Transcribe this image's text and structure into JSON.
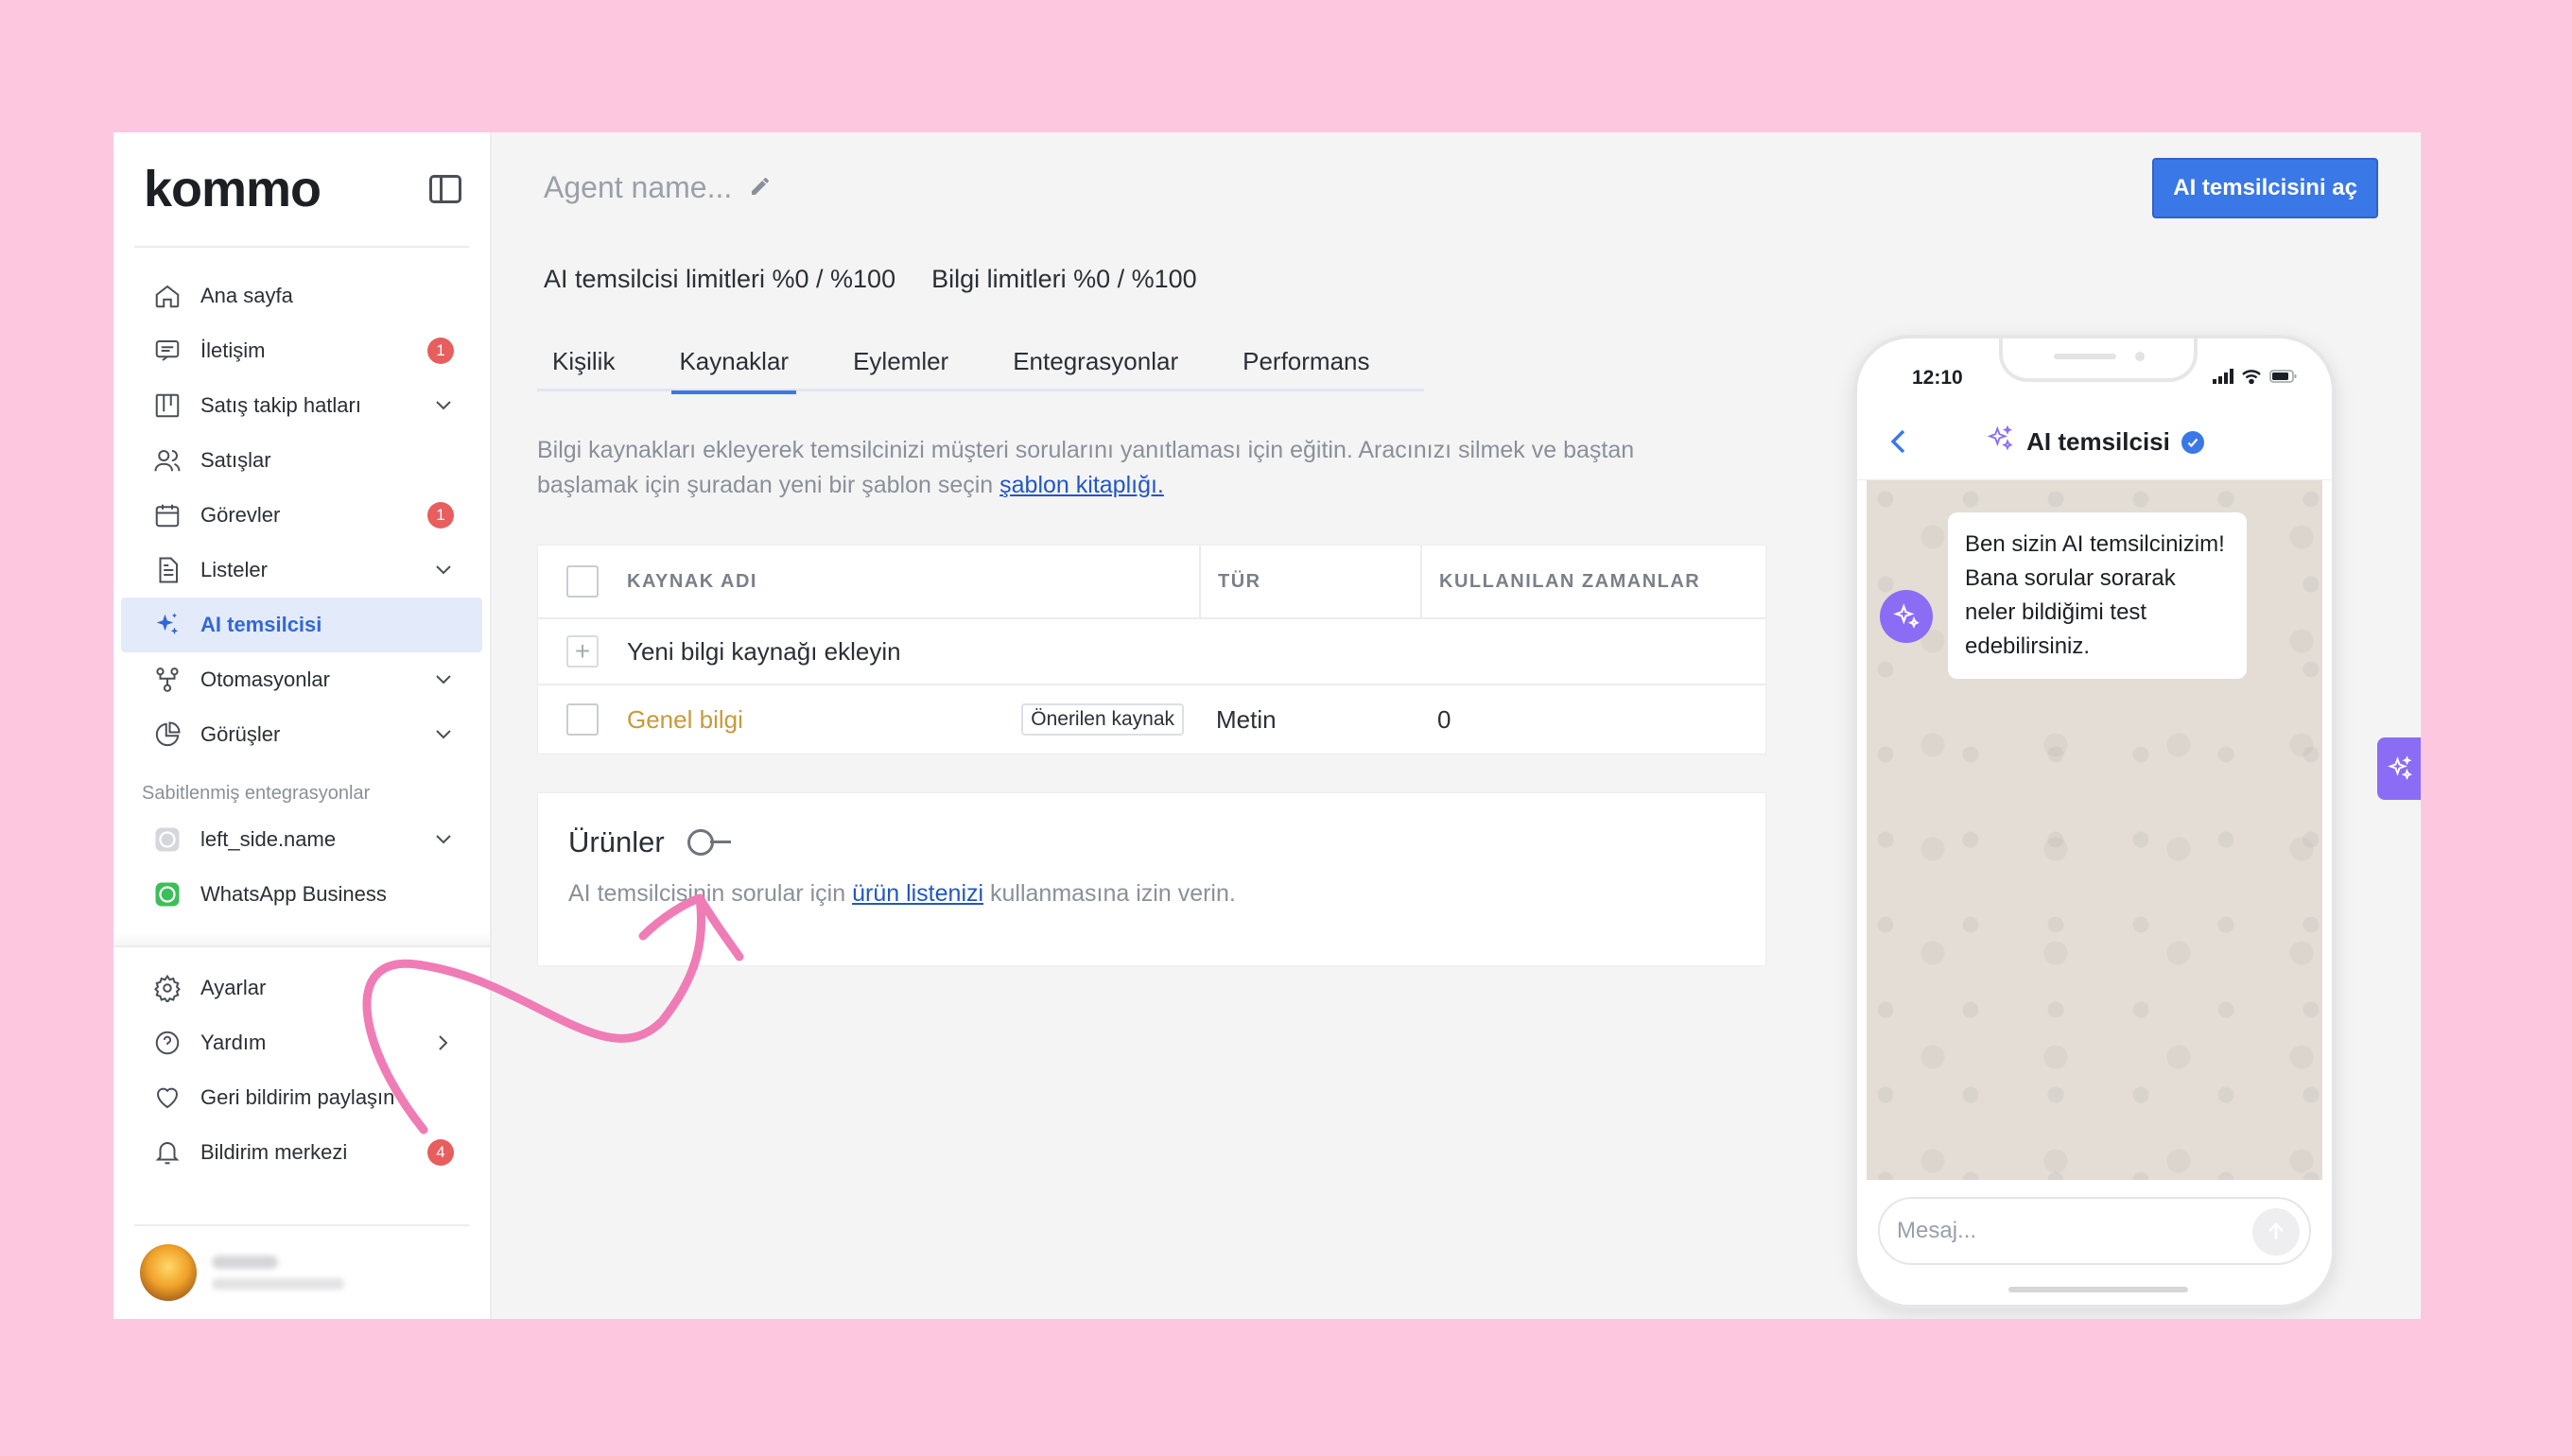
{
  "colors": {
    "background": "#fdc8df",
    "accent": "#3b78e7",
    "badge": "#e85d5d",
    "ai_purple": "#8a6cf5",
    "link": "#2256c6",
    "source_name": "#c79a3a",
    "annotation_arrow": "#f07cb6"
  },
  "sidebar": {
    "logo": "kommo",
    "collapse_icon": "sidebar-panel-icon",
    "items": [
      {
        "label": "Ana sayfa",
        "icon": "home-icon"
      },
      {
        "label": "İletişim",
        "icon": "chat-icon",
        "badge": "1"
      },
      {
        "label": "Satış takip hatları",
        "icon": "pipeline-icon",
        "chevron": true
      },
      {
        "label": "Satışlar",
        "icon": "users-icon"
      },
      {
        "label": "Görevler",
        "icon": "calendar-icon",
        "badge": "1"
      },
      {
        "label": "Listeler",
        "icon": "document-icon",
        "chevron": true
      },
      {
        "label": "AI temsilcisi",
        "icon": "sparkle-icon",
        "active": true
      },
      {
        "label": "Otomasyonlar",
        "icon": "flow-icon",
        "chevron": true
      },
      {
        "label": "Görüşler",
        "icon": "pie-chart-icon",
        "chevron": true
      }
    ],
    "pinned_label": "Sabitlenmiş entegrasyonlar",
    "pinned": [
      {
        "label": "left_side.name",
        "icon": "whatsapp-gray-icon",
        "chevron": true
      },
      {
        "label": "WhatsApp Business",
        "icon": "whatsapp-icon"
      }
    ],
    "bottom": [
      {
        "label": "Ayarlar",
        "icon": "gear-icon"
      },
      {
        "label": "Yardım",
        "icon": "help-icon",
        "chevron_right": true
      },
      {
        "label": "Geri bildirim paylaşın",
        "icon": "heart-icon"
      },
      {
        "label": "Bildirim merkezi",
        "icon": "bell-icon",
        "badge": "4"
      }
    ]
  },
  "header": {
    "agent_name_placeholder": "Agent name...",
    "open_button": "AI temsilcisini aç"
  },
  "limits": {
    "agent": "AI temsilcisi limitleri %0 / %100",
    "knowledge": "Bilgi limitleri %0 / %100"
  },
  "tabs": [
    {
      "label": "Kişilik"
    },
    {
      "label": "Kaynaklar",
      "active": true
    },
    {
      "label": "Eylemler"
    },
    {
      "label": "Entegrasyonlar"
    },
    {
      "label": "Performans"
    }
  ],
  "intro": {
    "text": "Bilgi kaynakları ekleyerek temsilcinizi müşteri sorularını yanıtlaması için eğitin. Aracınızı silmek ve baştan başlamak için şuradan yeni bir şablon seçin ",
    "link": "şablon kitaplığı."
  },
  "table": {
    "headers": {
      "name": "KAYNAK ADI",
      "type": "TÜR",
      "used": "KULLANILAN ZAMANLAR"
    },
    "add_row": "Yeni bilgi kaynağı ekleyin",
    "rows": [
      {
        "name": "Genel bilgi",
        "tag": "Önerilen kaynak",
        "type": "Metin",
        "used": "0"
      }
    ]
  },
  "products": {
    "title": "Ürünler",
    "toggle_on": false,
    "desc_before": "AI temsilcisinin sorular için ",
    "desc_link": "ürün listenizi",
    "desc_after": " kullanmasına izin verin."
  },
  "phone": {
    "time": "12:10",
    "title": "AI temsilcisi",
    "bubble": "Ben sizin AI temsilcinizim! Bana sorular sorarak neler bildiğimi test edebilirsiniz.",
    "input_placeholder": "Mesaj..."
  }
}
